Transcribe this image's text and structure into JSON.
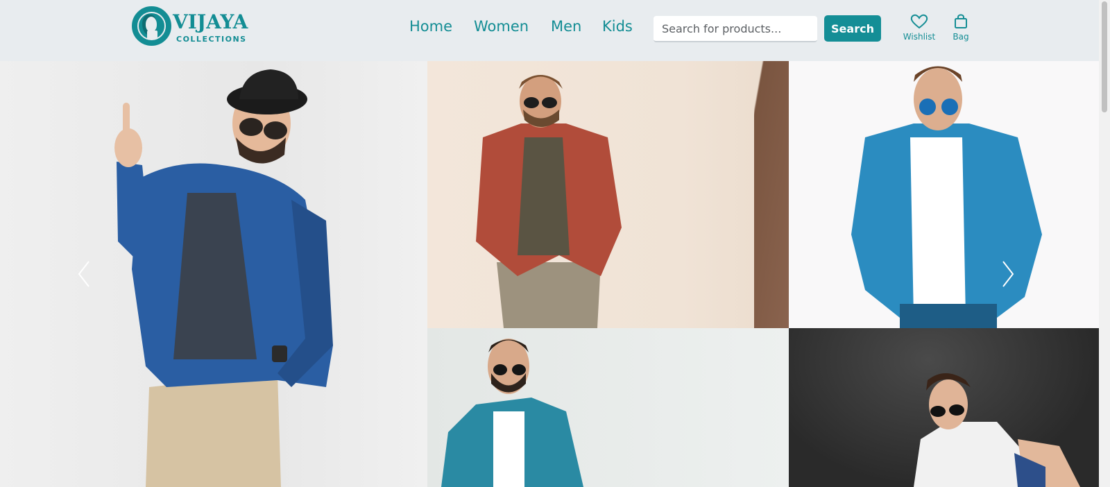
{
  "brand": {
    "name": "VIJAYA",
    "sub": "COLLECTIONS",
    "color": "#138d94"
  },
  "nav": [
    {
      "label": "Home"
    },
    {
      "label": "Women"
    },
    {
      "label": "Men"
    },
    {
      "label": "Kids"
    }
  ],
  "search": {
    "placeholder": "Search for products...",
    "button_label": "Search"
  },
  "actions": {
    "wishlist_label": "Wishlist",
    "bag_label": "Bag"
  },
  "hero": {
    "tiles": [
      {
        "icon": "photo-man-denim-shirt-hat"
      },
      {
        "icon": "photo-man-plaid-shirt"
      },
      {
        "icon": "photo-man-denim-shirt-white-tee"
      },
      {
        "icon": "photo-man-denim-jacket"
      },
      {
        "icon": "photo-man-white-tee-dark-bg"
      }
    ],
    "prev_icon": "chevron-left-icon",
    "next_icon": "chevron-right-icon"
  },
  "colors": {
    "accent": "#148e96",
    "header_bg": "#e8ecef"
  }
}
